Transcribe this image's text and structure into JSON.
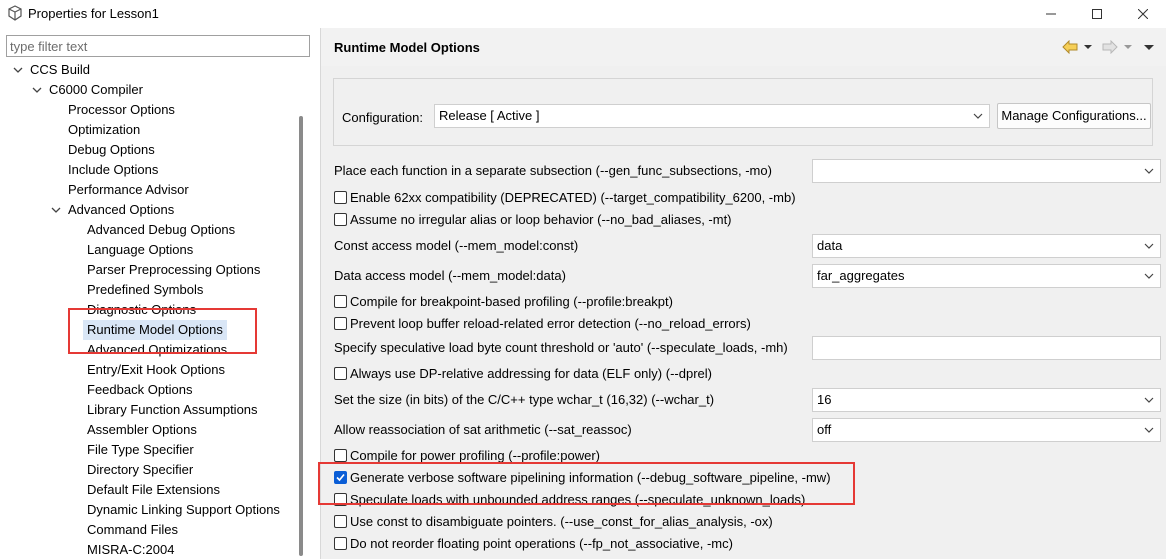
{
  "window": {
    "title": "Properties for Lesson1",
    "minimize_icon": "minimize-icon",
    "maximize_icon": "maximize-icon",
    "close_icon": "close-icon"
  },
  "sidebar": {
    "filter_placeholder": "type filter text",
    "nodes": [
      {
        "label": "CCS Build",
        "level": 0,
        "expanded": true
      },
      {
        "label": "C6000 Compiler",
        "level": 1,
        "expanded": true
      },
      {
        "label": "Processor Options",
        "level": 2
      },
      {
        "label": "Optimization",
        "level": 2
      },
      {
        "label": "Debug Options",
        "level": 2
      },
      {
        "label": "Include Options",
        "level": 2
      },
      {
        "label": "Performance Advisor",
        "level": 2
      },
      {
        "label": "Advanced Options",
        "level": 2,
        "expanded": true
      },
      {
        "label": "Advanced Debug Options",
        "level": 3
      },
      {
        "label": "Language Options",
        "level": 3
      },
      {
        "label": "Parser Preprocessing Options",
        "level": 3
      },
      {
        "label": "Predefined Symbols",
        "level": 3
      },
      {
        "label": "Diagnostic Options",
        "level": 3
      },
      {
        "label": "Runtime Model Options",
        "level": 3,
        "selected": true
      },
      {
        "label": "Advanced Optimizations",
        "level": 3
      },
      {
        "label": "Entry/Exit Hook Options",
        "level": 3
      },
      {
        "label": "Feedback Options",
        "level": 3
      },
      {
        "label": "Library Function Assumptions",
        "level": 3
      },
      {
        "label": "Assembler Options",
        "level": 3
      },
      {
        "label": "File Type Specifier",
        "level": 3
      },
      {
        "label": "Directory Specifier",
        "level": 3
      },
      {
        "label": "Default File Extensions",
        "level": 3
      },
      {
        "label": "Dynamic Linking Support Options",
        "level": 3
      },
      {
        "label": "Command Files",
        "level": 3
      },
      {
        "label": "MISRA-C:2004",
        "level": 3
      }
    ]
  },
  "header": {
    "title": "Runtime Model Options",
    "back_icon": "back-arrow-icon",
    "forward_icon": "forward-arrow-icon",
    "menu_icon": "view-menu-icon"
  },
  "config": {
    "label": "Configuration:",
    "value": "Release  [ Active ]",
    "manage_button": "Manage Configurations..."
  },
  "options": [
    {
      "type": "select",
      "label": "Place each function in a separate subsection (--gen_func_subsections, -mo)",
      "value": ""
    },
    {
      "type": "checkbox",
      "label": "Enable 62xx compatibility (DEPRECATED) (--target_compatibility_6200, -mb)",
      "checked": false
    },
    {
      "type": "checkbox",
      "label": "Assume no irregular alias or loop behavior (--no_bad_aliases, -mt)",
      "checked": false
    },
    {
      "type": "select",
      "label": "Const access model (--mem_model:const)",
      "value": "data"
    },
    {
      "type": "select",
      "label": "Data access model (--mem_model:data)",
      "value": "far_aggregates"
    },
    {
      "type": "checkbox",
      "label": "Compile for breakpoint-based profiling (--profile:breakpt)",
      "checked": false
    },
    {
      "type": "checkbox",
      "label": "Prevent loop buffer reload-related error detection (--no_reload_errors)",
      "checked": false
    },
    {
      "type": "text",
      "label": "Specify speculative load byte count threshold or 'auto' (--speculate_loads, -mh)",
      "value": ""
    },
    {
      "type": "checkbox",
      "label": "Always use DP-relative addressing for data (ELF only) (--dprel)",
      "checked": false
    },
    {
      "type": "select",
      "label": "Set the size (in bits) of the C/C++ type wchar_t (16,32) (--wchar_t)",
      "value": "16"
    },
    {
      "type": "select",
      "label": "Allow reassociation of sat arithmetic (--sat_reassoc)",
      "value": "off"
    },
    {
      "type": "checkbox",
      "label": "Compile for power profiling (--profile:power)",
      "checked": false
    },
    {
      "type": "checkbox",
      "label": "Generate verbose software pipelining information (--debug_software_pipeline, -mw)",
      "checked": true
    },
    {
      "type": "checkbox",
      "label": "Speculate loads with unbounded address ranges (--speculate_unknown_loads)",
      "checked": false
    },
    {
      "type": "checkbox",
      "label": "Use const to disambiguate pointers. (--use_const_for_alias_analysis, -ox)",
      "checked": false
    },
    {
      "type": "checkbox",
      "label": "Do not reorder floating point operations (--fp_not_associative, -mc)",
      "checked": false
    }
  ],
  "colors": {
    "highlight_box": "#e53935",
    "selection_bg": "#d9e6f6",
    "checkbox_checked": "#0a5dd6"
  }
}
